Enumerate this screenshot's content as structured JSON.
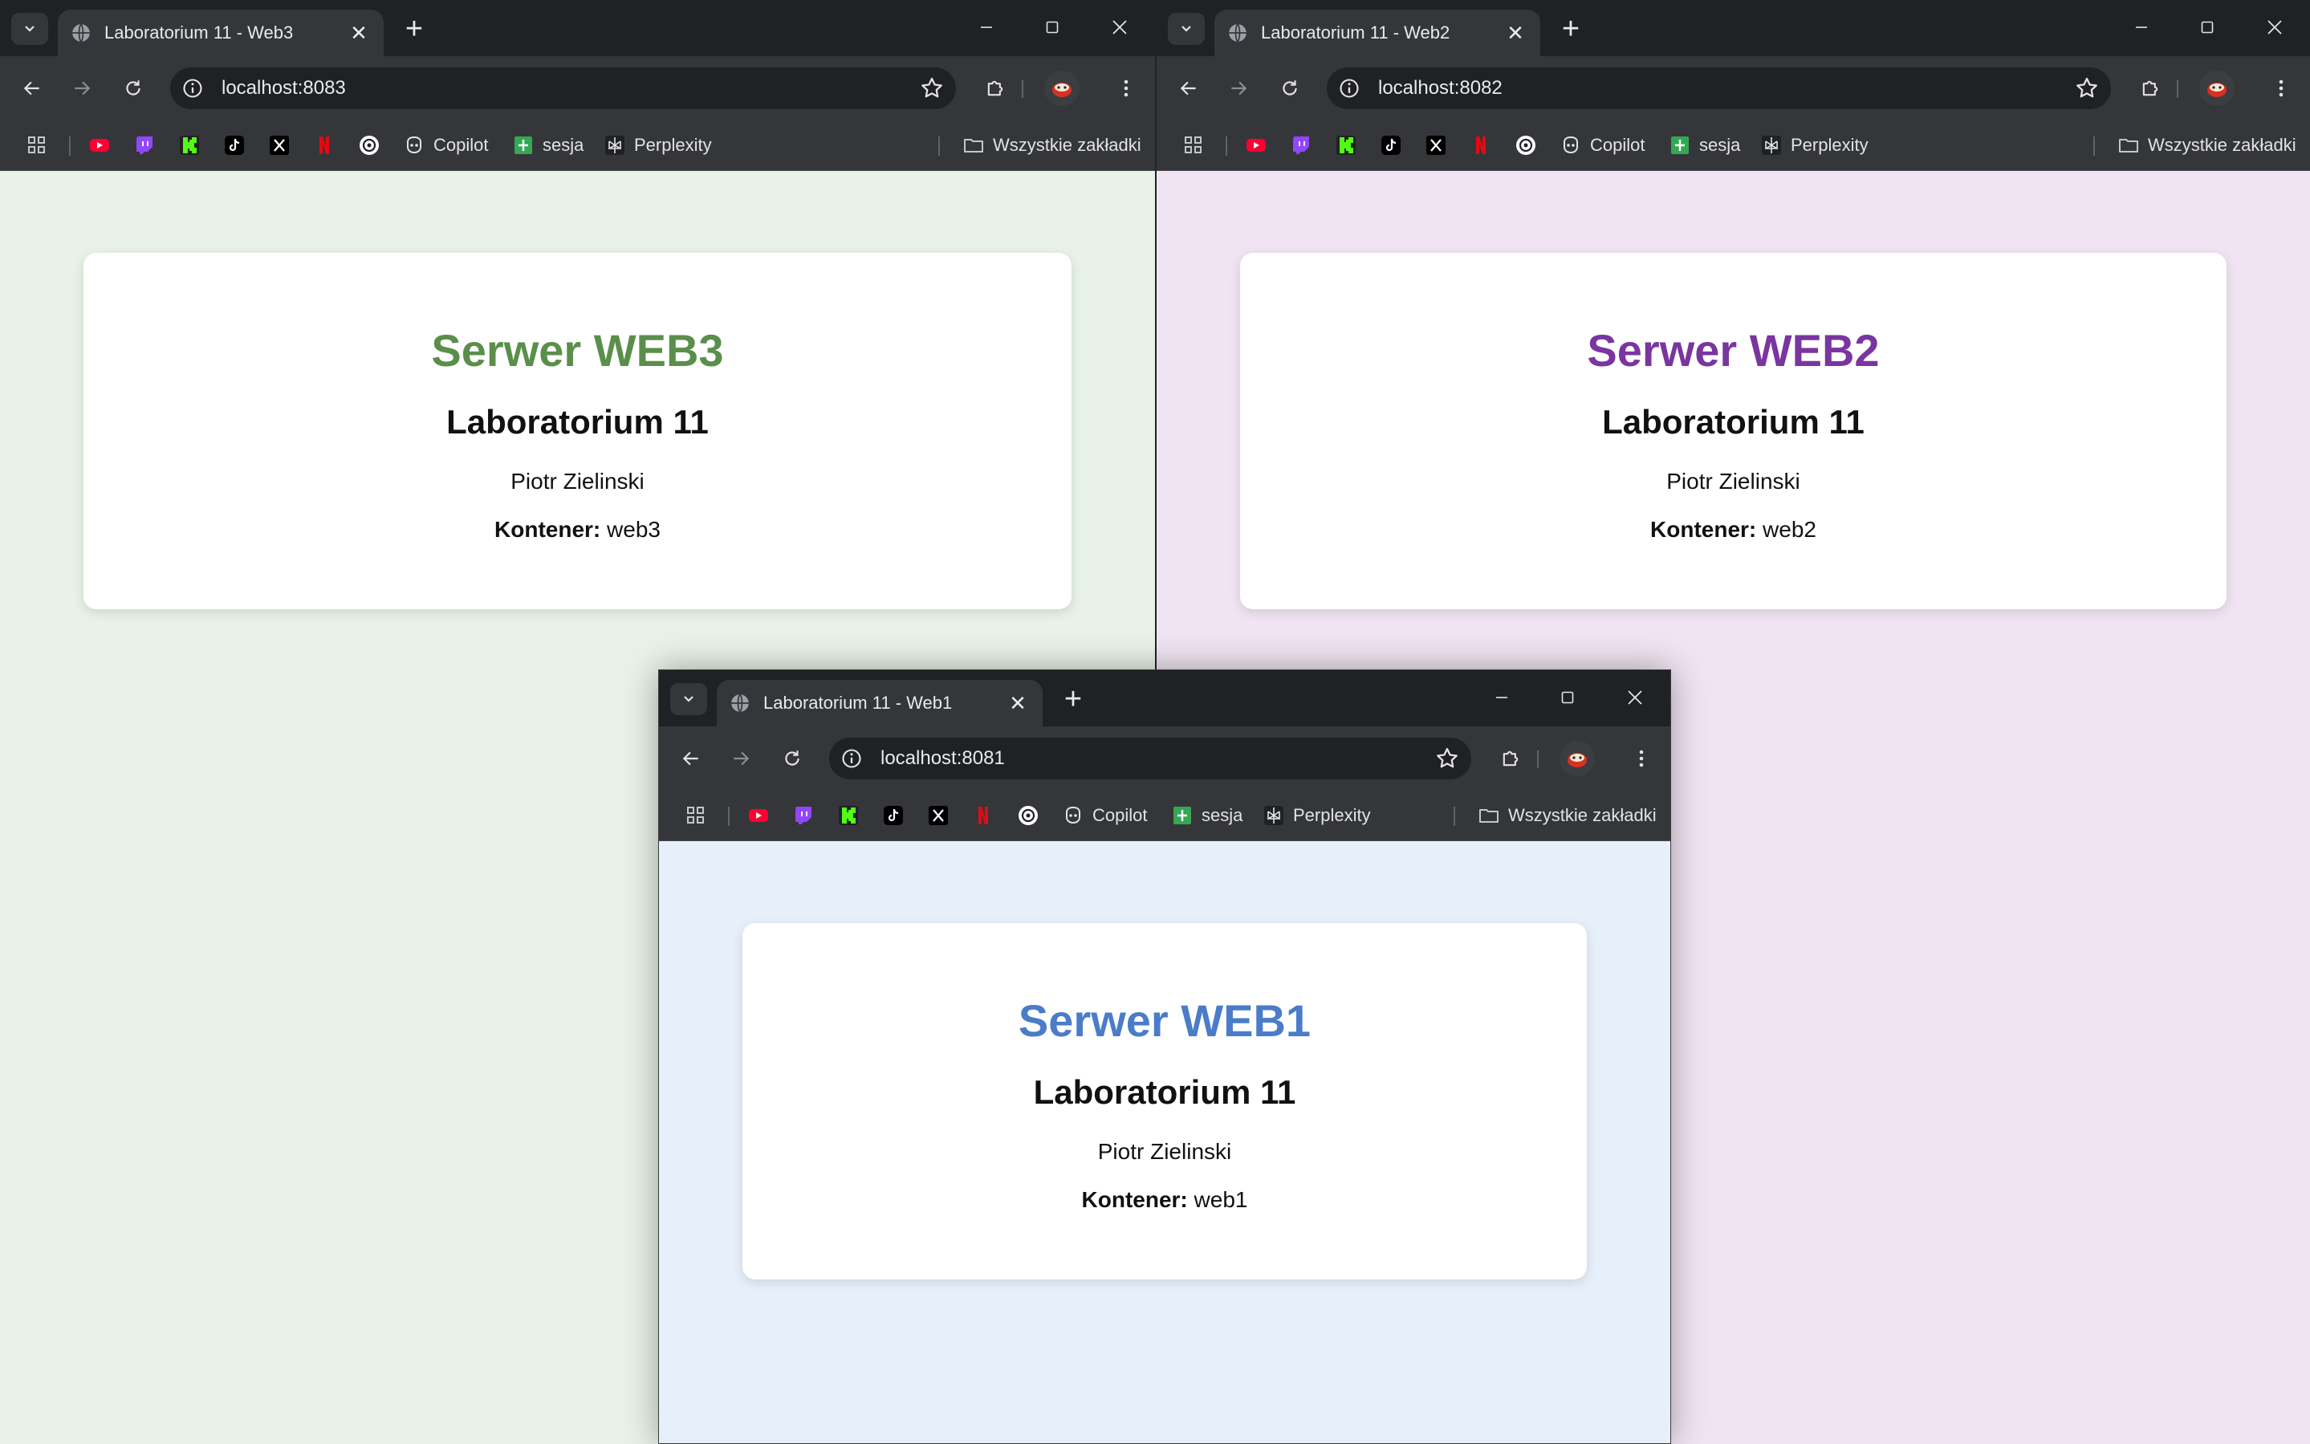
{
  "windows": {
    "web3": {
      "tab_title": "Laboratorium 11 - Web3",
      "url": "localhost:8083",
      "page_bg": "#e8f2e8",
      "accent": "#5a8f4b",
      "heading": "Serwer WEB3",
      "subheading": "Laboratorium 11",
      "author": "Piotr Zielinski",
      "container_label": "Kontener:",
      "container_value": "web3"
    },
    "web2": {
      "tab_title": "Laboratorium 11 - Web2",
      "url": "localhost:8082",
      "page_bg": "#f0e4f2",
      "accent": "#7a35a0",
      "heading": "Serwer WEB2",
      "subheading": "Laboratorium 11",
      "author": "Piotr Zielinski",
      "container_label": "Kontener:",
      "container_value": "web2"
    },
    "web1": {
      "tab_title": "Laboratorium 11 - Web1",
      "url": "localhost:8081",
      "page_bg": "#e7f0fa",
      "accent": "#4a7cc9",
      "heading": "Serwer WEB1",
      "subheading": "Laboratorium 11",
      "author": "Piotr Zielinski",
      "container_label": "Kontener:",
      "container_value": "web1"
    }
  },
  "bookmarks": {
    "items": [
      {
        "icon": "youtube-icon",
        "label": ""
      },
      {
        "icon": "twitch-icon",
        "label": ""
      },
      {
        "icon": "kick-icon",
        "label": ""
      },
      {
        "icon": "tiktok-icon",
        "label": ""
      },
      {
        "icon": "x-icon",
        "label": ""
      },
      {
        "icon": "netflix-icon",
        "label": ""
      },
      {
        "icon": "chatgpt-icon",
        "label": ""
      },
      {
        "icon": "copilot-icon",
        "label": "Copilot"
      },
      {
        "icon": "sheets-icon",
        "label": "sesja"
      },
      {
        "icon": "perplexity-icon",
        "label": "Perplexity"
      }
    ],
    "all_bookmarks": "Wszystkie zakładki"
  }
}
